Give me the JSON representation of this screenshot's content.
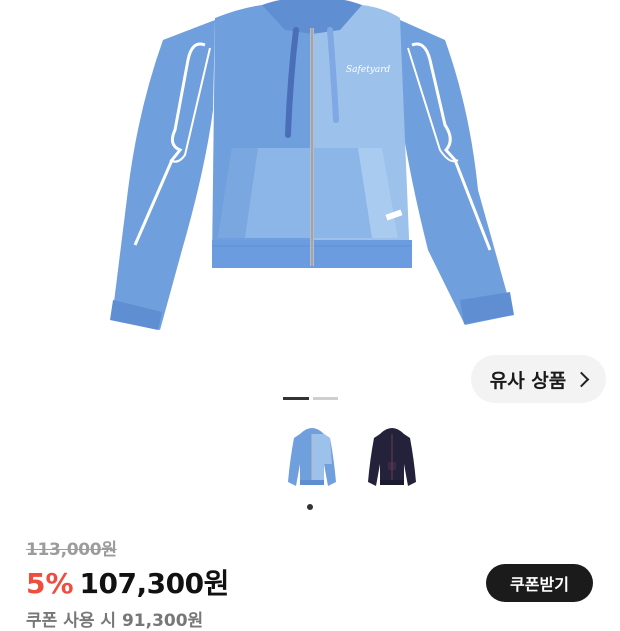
{
  "product_image": {
    "alt": "blue zip-up hoodie",
    "chest_logo": "Safetyard"
  },
  "similar_products": {
    "label": "유사 상품"
  },
  "pager": {
    "current": 1,
    "total": 2
  },
  "color_options": [
    {
      "name": "blue",
      "selected": true
    },
    {
      "name": "navy",
      "selected": false
    }
  ],
  "pricing": {
    "original_price": "113,000원",
    "discount_rate": "5%",
    "sale_price": "107,300원",
    "coupon_button": "쿠폰받기",
    "coupon_price_note": "쿠폰 사용 시 91,300원"
  },
  "colors": {
    "discount": "#ef4d3d",
    "hoodie_blue": "#6f9fdc",
    "hoodie_light": "#9cc1ea",
    "hoodie_navy": "#24213a"
  }
}
